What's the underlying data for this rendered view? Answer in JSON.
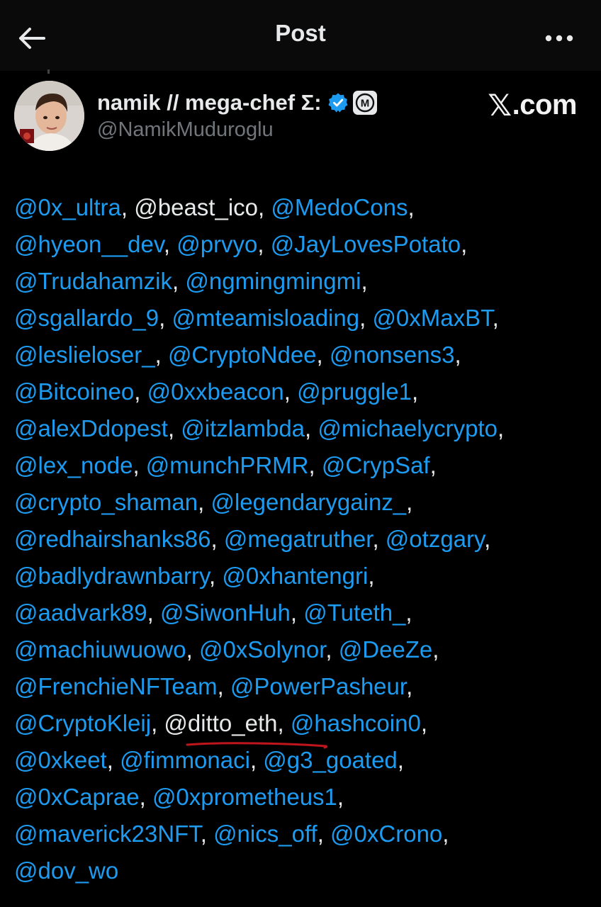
{
  "header": {
    "title": "Post",
    "back_icon": "back-arrow-icon",
    "more_icon": "more-horizontal-icon"
  },
  "watermark": {
    "x_glyph": "𝕏",
    "text": ".com"
  },
  "author": {
    "name": "namik // mega-chef Σ:",
    "handle": "@NamikMuduroglu",
    "verified_icon": "verified-badge-icon",
    "affiliate_badge_letter": "M"
  },
  "colors": {
    "background": "#000000",
    "link": "#1d9bf0",
    "text": "#e7e9ea",
    "secondary": "#71767b",
    "underline": "#c0151c"
  },
  "post": {
    "lines": [
      {
        "items": [
          {
            "text": "@0x_ultra",
            "sep": ", "
          },
          {
            "text": "@beast_ico",
            "sep": ", ",
            "plain": true
          },
          {
            "text": "@MedoCons",
            "sep": ","
          }
        ]
      },
      {
        "items": [
          {
            "text": "@hyeon__dev",
            "sep": ", "
          },
          {
            "text": "@prvyo",
            "sep": ", "
          },
          {
            "text": "@JayLovesPotato",
            "sep": ","
          }
        ]
      },
      {
        "items": [
          {
            "text": "@Trudahamzik",
            "sep": ", "
          },
          {
            "text": "@ngmingmingmi",
            "sep": ","
          }
        ]
      },
      {
        "items": [
          {
            "text": "@sgallardo_9",
            "sep": ", "
          },
          {
            "text": "@mteamisloading",
            "sep": ", "
          },
          {
            "text": "@0xMaxBT",
            "sep": ","
          }
        ]
      },
      {
        "items": [
          {
            "text": "@leslieloser_",
            "sep": ", "
          },
          {
            "text": "@CryptoNdee",
            "sep": ", "
          },
          {
            "text": "@nonsens3",
            "sep": ","
          }
        ]
      },
      {
        "items": [
          {
            "text": "@Bitcoineo",
            "sep": ", "
          },
          {
            "text": "@0xxbeacon",
            "sep": ", "
          },
          {
            "text": "@pruggle1",
            "sep": ","
          }
        ]
      },
      {
        "items": [
          {
            "text": "@alexDdopest",
            "sep": ", "
          },
          {
            "text": "@itzlambda",
            "sep": ", "
          },
          {
            "text": "@michaelycrypto",
            "sep": ","
          }
        ]
      },
      {
        "items": [
          {
            "text": "@lex_node",
            "sep": ", "
          },
          {
            "text": "@munchPRMR",
            "sep": ", "
          },
          {
            "text": "@CrypSaf",
            "sep": ","
          }
        ]
      },
      {
        "items": [
          {
            "text": "@crypto_shaman",
            "sep": ", "
          },
          {
            "text": "@legendarygainz_",
            "sep": ","
          }
        ]
      },
      {
        "items": [
          {
            "text": "@redhairshanks86",
            "sep": ", "
          },
          {
            "text": "@megatruther",
            "sep": ", "
          },
          {
            "text": "@otzgary",
            "sep": ","
          }
        ]
      },
      {
        "items": [
          {
            "text": "@badlydrawnbarry",
            "sep": ", "
          },
          {
            "text": "@0xhantengri",
            "sep": ","
          }
        ]
      },
      {
        "items": [
          {
            "text": "@aadvark89",
            "sep": ", "
          },
          {
            "text": "@SiwonHuh",
            "sep": ", "
          },
          {
            "text": "@Tuteth_",
            "sep": ","
          }
        ]
      },
      {
        "items": [
          {
            "text": "@machiuwuowo",
            "sep": ", "
          },
          {
            "text": "@0xSolynor",
            "sep": ", "
          },
          {
            "text": "@DeeZe",
            "sep": ","
          }
        ]
      },
      {
        "items": [
          {
            "text": "@FrenchieNFTeam",
            "sep": ", "
          },
          {
            "text": "@PowerPasheur",
            "sep": ","
          }
        ]
      },
      {
        "items": [
          {
            "text": "@CryptoKleij",
            "sep": ", "
          },
          {
            "text": "@ditto_eth",
            "sep": ", ",
            "plain": true
          },
          {
            "text": "@hashcoin0",
            "sep": ","
          }
        ]
      },
      {
        "items": [
          {
            "text": "@0xkeet",
            "sep": ", "
          },
          {
            "text": "@fimmonaci",
            "sep": ", "
          },
          {
            "text": "@g3_goated",
            "sep": ","
          }
        ]
      },
      {
        "items": [
          {
            "text": "@0xCaprae",
            "sep": ", "
          },
          {
            "text": "@0xprometheus1",
            "sep": ","
          }
        ]
      },
      {
        "items": [
          {
            "text": "@maverick23NFT",
            "sep": ", "
          },
          {
            "text": "@nics_off",
            "sep": ", "
          },
          {
            "text": "@0xCrono",
            "sep": ","
          }
        ]
      },
      {
        "items": [
          {
            "text": "@dov_wo",
            "sep": ""
          }
        ]
      }
    ]
  }
}
